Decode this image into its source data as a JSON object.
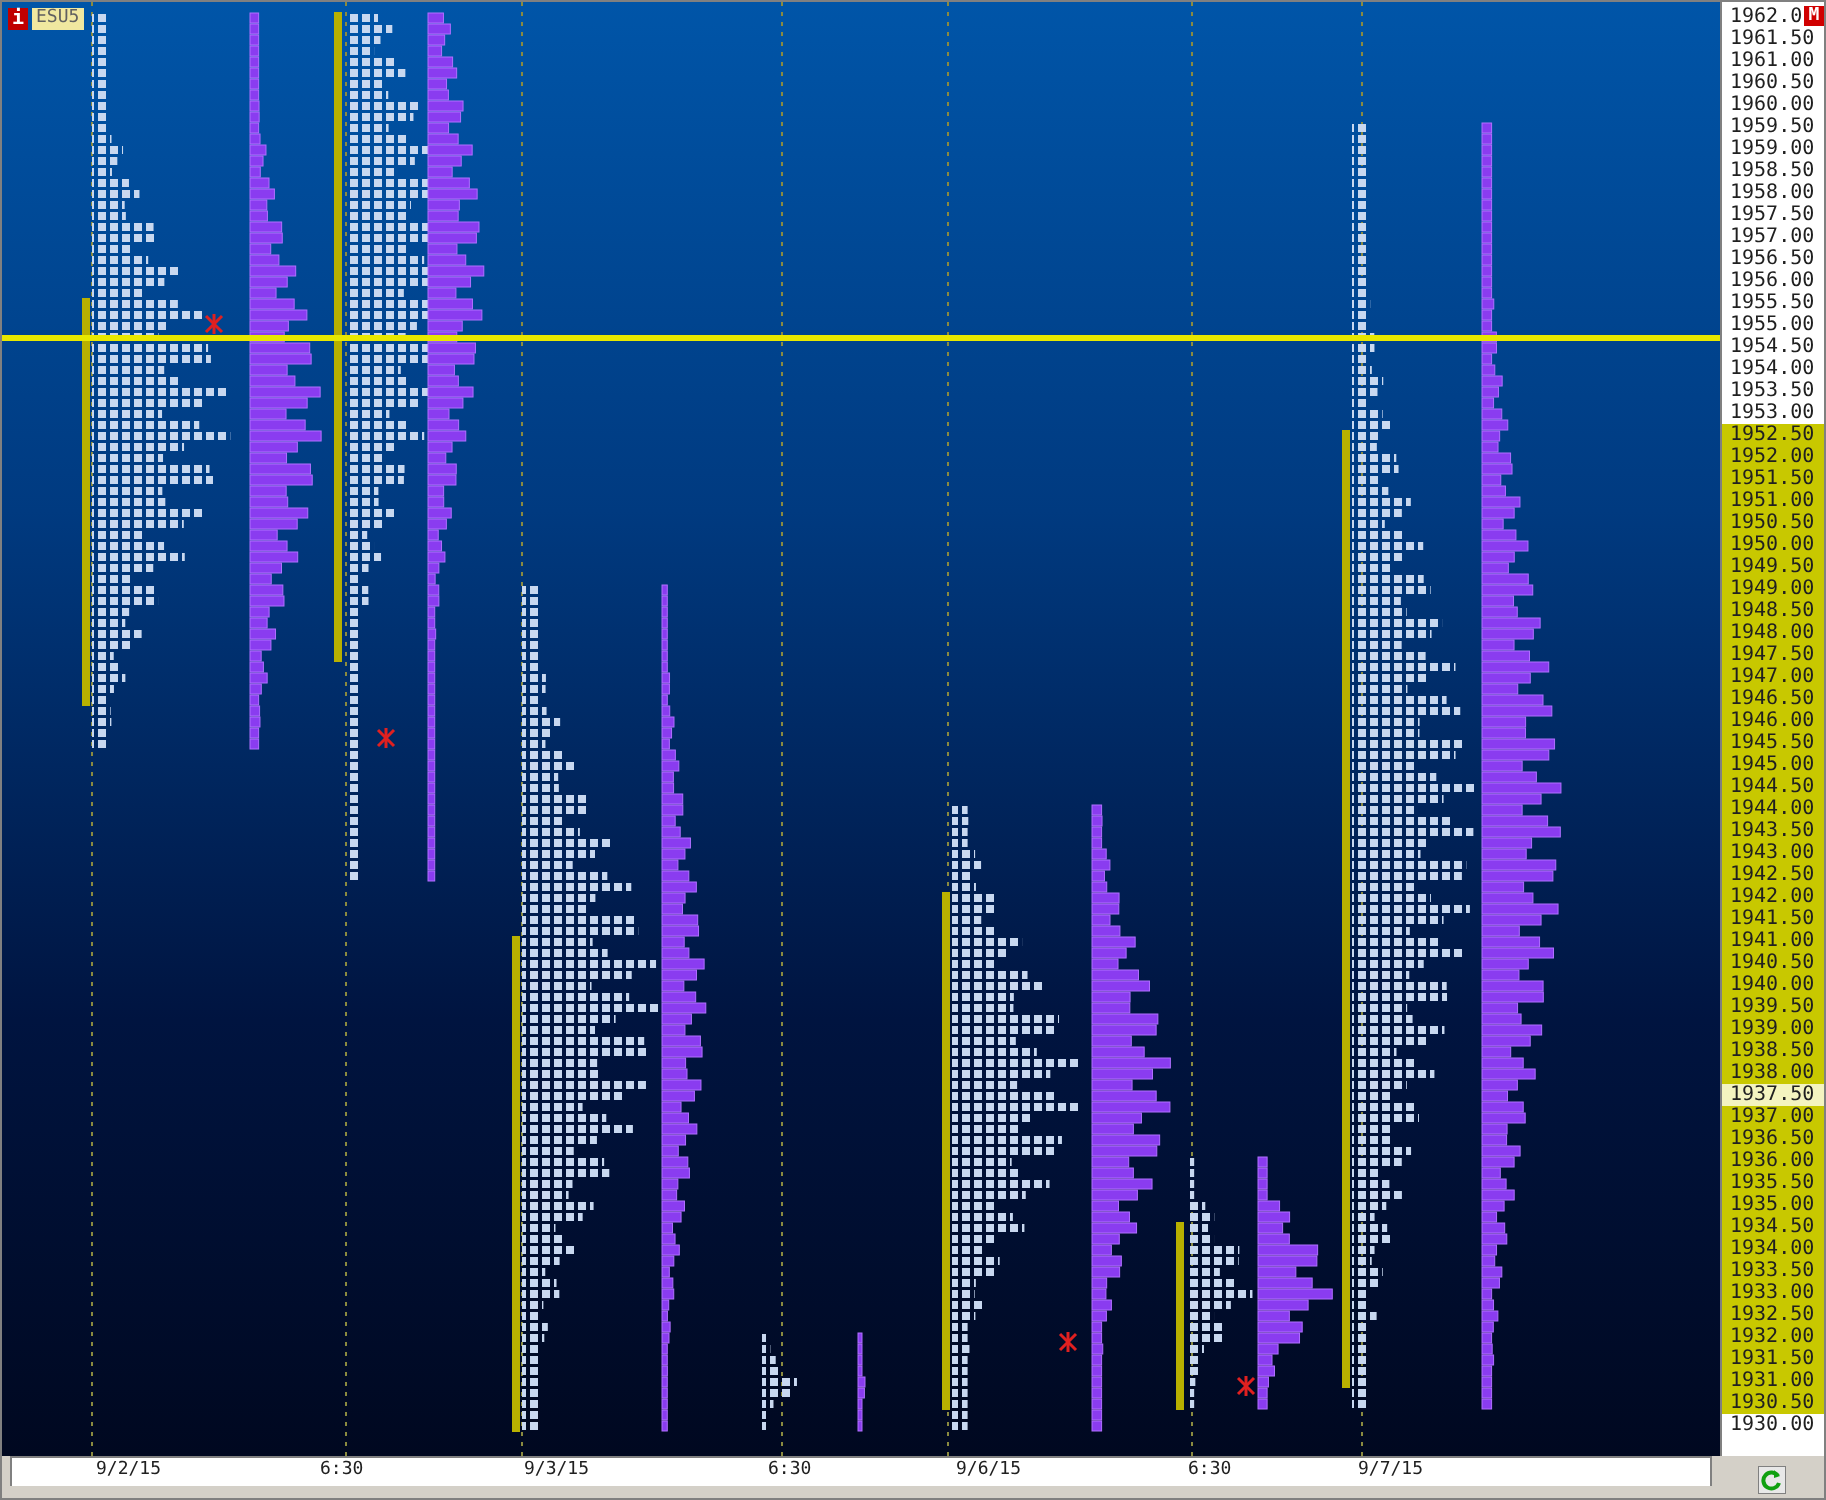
{
  "symbol": {
    "badge": "i",
    "ticker": "ESU5"
  },
  "price_axis": {
    "corner_badge": "M",
    "labels": [
      {
        "text": "1962.0",
        "highlighted": false,
        "marked": false
      },
      {
        "text": "1961.50",
        "highlighted": false,
        "marked": false
      },
      {
        "text": "1961.00",
        "highlighted": false,
        "marked": false
      },
      {
        "text": "1960.50",
        "highlighted": false,
        "marked": false
      },
      {
        "text": "1960.00",
        "highlighted": false,
        "marked": false
      },
      {
        "text": "1959.50",
        "highlighted": false,
        "marked": false
      },
      {
        "text": "1959.00",
        "highlighted": false,
        "marked": false
      },
      {
        "text": "1958.50",
        "highlighted": false,
        "marked": false
      },
      {
        "text": "1958.00",
        "highlighted": false,
        "marked": false
      },
      {
        "text": "1957.50",
        "highlighted": false,
        "marked": false
      },
      {
        "text": "1957.00",
        "highlighted": false,
        "marked": false
      },
      {
        "text": "1956.50",
        "highlighted": false,
        "marked": false
      },
      {
        "text": "1956.00",
        "highlighted": false,
        "marked": false
      },
      {
        "text": "1955.50",
        "highlighted": false,
        "marked": false
      },
      {
        "text": "1955.00",
        "highlighted": false,
        "marked": false
      },
      {
        "text": "1954.50",
        "highlighted": false,
        "marked": false
      },
      {
        "text": "1954.00",
        "highlighted": false,
        "marked": false
      },
      {
        "text": "1953.50",
        "highlighted": false,
        "marked": false
      },
      {
        "text": "1953.00",
        "highlighted": false,
        "marked": false
      },
      {
        "text": "1952.50",
        "highlighted": true,
        "marked": false
      },
      {
        "text": "1952.00",
        "highlighted": true,
        "marked": false
      },
      {
        "text": "1951.50",
        "highlighted": true,
        "marked": false
      },
      {
        "text": "1951.00",
        "highlighted": true,
        "marked": false
      },
      {
        "text": "1950.50",
        "highlighted": true,
        "marked": false
      },
      {
        "text": "1950.00",
        "highlighted": true,
        "marked": false
      },
      {
        "text": "1949.50",
        "highlighted": true,
        "marked": false
      },
      {
        "text": "1949.00",
        "highlighted": true,
        "marked": false
      },
      {
        "text": "1948.50",
        "highlighted": true,
        "marked": false
      },
      {
        "text": "1948.00",
        "highlighted": true,
        "marked": false
      },
      {
        "text": "1947.50",
        "highlighted": true,
        "marked": false
      },
      {
        "text": "1947.00",
        "highlighted": true,
        "marked": false
      },
      {
        "text": "1946.50",
        "highlighted": true,
        "marked": false
      },
      {
        "text": "1946.00",
        "highlighted": true,
        "marked": false
      },
      {
        "text": "1945.50",
        "highlighted": true,
        "marked": false
      },
      {
        "text": "1945.00",
        "highlighted": true,
        "marked": false
      },
      {
        "text": "1944.50",
        "highlighted": true,
        "marked": false
      },
      {
        "text": "1944.00",
        "highlighted": true,
        "marked": false
      },
      {
        "text": "1943.50",
        "highlighted": true,
        "marked": false
      },
      {
        "text": "1943.00",
        "highlighted": true,
        "marked": false
      },
      {
        "text": "1942.50",
        "highlighted": true,
        "marked": false
      },
      {
        "text": "1942.00",
        "highlighted": true,
        "marked": false
      },
      {
        "text": "1941.50",
        "highlighted": true,
        "marked": false
      },
      {
        "text": "1941.00",
        "highlighted": true,
        "marked": false
      },
      {
        "text": "1940.50",
        "highlighted": true,
        "marked": false
      },
      {
        "text": "1940.00",
        "highlighted": true,
        "marked": false
      },
      {
        "text": "1939.50",
        "highlighted": true,
        "marked": false
      },
      {
        "text": "1939.00",
        "highlighted": true,
        "marked": false
      },
      {
        "text": "1938.50",
        "highlighted": true,
        "marked": false
      },
      {
        "text": "1938.00",
        "highlighted": true,
        "marked": false
      },
      {
        "text": "1937.50",
        "highlighted": true,
        "marked": true
      },
      {
        "text": "1937.00",
        "highlighted": true,
        "marked": false
      },
      {
        "text": "1936.50",
        "highlighted": true,
        "marked": false
      },
      {
        "text": "1936.00",
        "highlighted": true,
        "marked": false
      },
      {
        "text": "1935.50",
        "highlighted": true,
        "marked": false
      },
      {
        "text": "1935.00",
        "highlighted": true,
        "marked": false
      },
      {
        "text": "1934.50",
        "highlighted": true,
        "marked": false
      },
      {
        "text": "1934.00",
        "highlighted": true,
        "marked": false
      },
      {
        "text": "1933.50",
        "highlighted": true,
        "marked": false
      },
      {
        "text": "1933.00",
        "highlighted": true,
        "marked": false
      },
      {
        "text": "1932.50",
        "highlighted": true,
        "marked": false
      },
      {
        "text": "1932.00",
        "highlighted": true,
        "marked": false
      },
      {
        "text": "1931.50",
        "highlighted": true,
        "marked": false
      },
      {
        "text": "1931.00",
        "highlighted": true,
        "marked": false
      },
      {
        "text": "1930.50",
        "highlighted": true,
        "marked": false
      },
      {
        "text": "1930.00",
        "highlighted": false,
        "marked": false
      }
    ]
  },
  "time_axis": {
    "labels": [
      "9/2/15",
      "6:30",
      "9/3/15",
      "6:30",
      "9/6/15",
      "6:30",
      "9/7/15"
    ]
  }
}
